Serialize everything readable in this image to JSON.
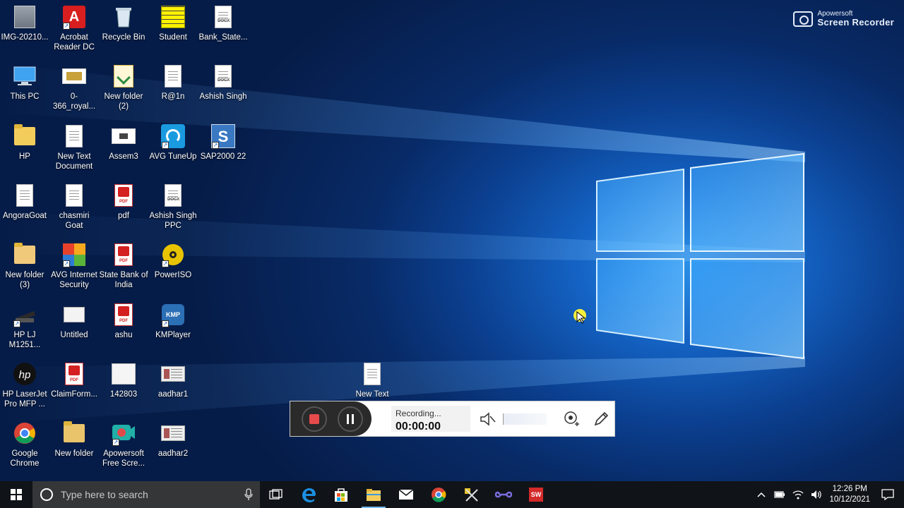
{
  "watermark": {
    "line1": "Apowersoft",
    "line2": "Screen Recorder"
  },
  "desktop_icons": [
    {
      "label": "IMG-20210..."
    },
    {
      "label": "Acrobat Reader DC"
    },
    {
      "label": "Recycle Bin"
    },
    {
      "label": "Student"
    },
    {
      "label": "Bank_State..."
    },
    {
      "label": "This PC"
    },
    {
      "label": "0-366_royal..."
    },
    {
      "label": "New folder (2)"
    },
    {
      "label": "R@1n"
    },
    {
      "label": "Ashish Singh"
    },
    {
      "label": "HP"
    },
    {
      "label": "New Text Document"
    },
    {
      "label": "Assem3"
    },
    {
      "label": "AVG TuneUp"
    },
    {
      "label": "SAP2000 22"
    },
    {
      "label": "AngoraGoat"
    },
    {
      "label": "chasmiri Goat"
    },
    {
      "label": "pdf"
    },
    {
      "label": "Ashish Singh PPC"
    },
    {
      "label": "New folder (3)"
    },
    {
      "label": "AVG Internet Security"
    },
    {
      "label": "State Bank of India"
    },
    {
      "label": "PowerISO"
    },
    {
      "label": "HP LJ M1251..."
    },
    {
      "label": "Untitled"
    },
    {
      "label": "ashu"
    },
    {
      "label": "KMPlayer"
    },
    {
      "label": "HP LaserJet Pro MFP ..."
    },
    {
      "label": "ClaimForm..."
    },
    {
      "label": "142803"
    },
    {
      "label": "aadhar1"
    },
    {
      "label": "Google Chrome"
    },
    {
      "label": "New folder"
    },
    {
      "label": "Apowersoft Free Scre..."
    },
    {
      "label": "aadhar2"
    },
    {
      "label": "New Text"
    }
  ],
  "recorder": {
    "status": "Recording...",
    "time": "00:00:00"
  },
  "taskbar": {
    "search_placeholder": "Type here to search",
    "time": "12:26 PM",
    "date": "10/12/2021",
    "apps": [
      "task-view",
      "edge",
      "store",
      "file-explorer",
      "mail",
      "chrome",
      "tool",
      "link",
      "solidworks"
    ]
  },
  "colors": {
    "accent": "#1463c4",
    "taskbar": "#101418",
    "record_red": "#e64b4b"
  }
}
